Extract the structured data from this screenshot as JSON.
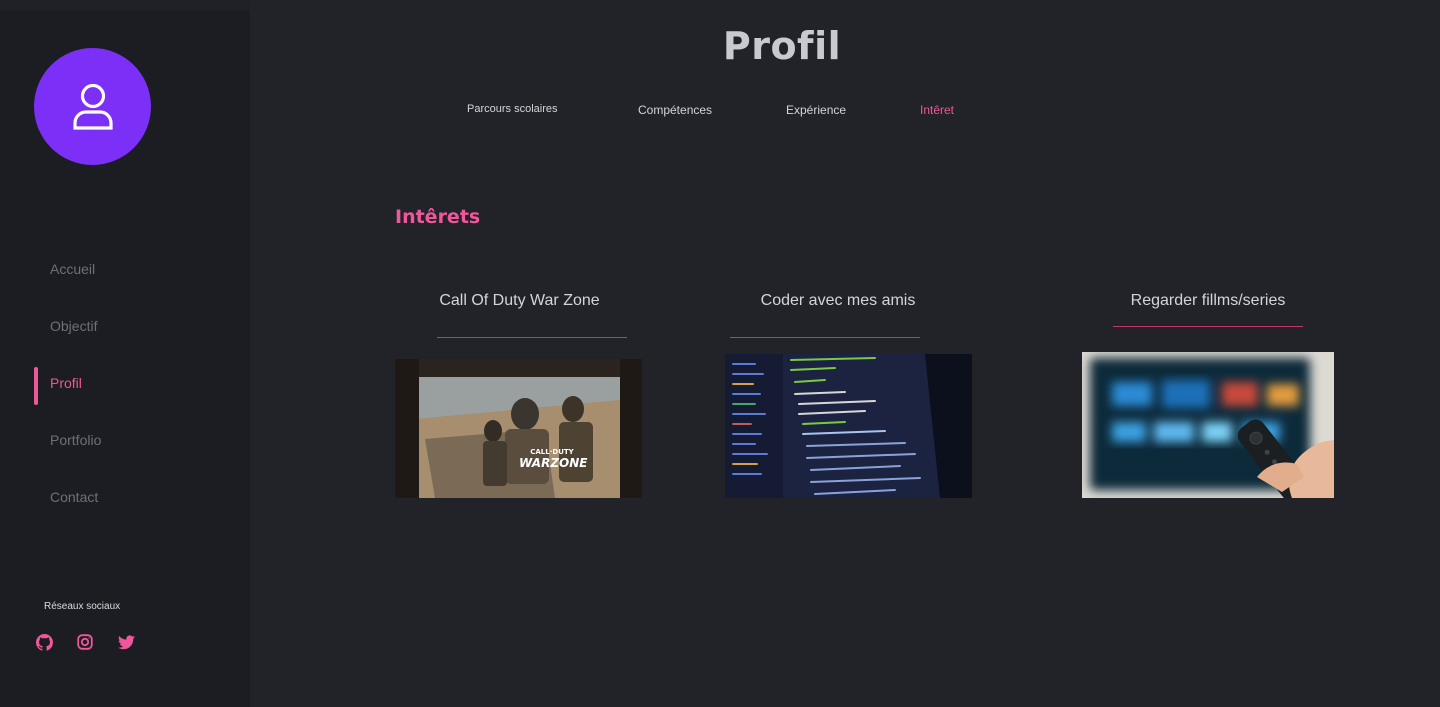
{
  "page": {
    "title": "Profil"
  },
  "sidebar": {
    "nav": [
      {
        "label": "Accueil"
      },
      {
        "label": "Objectif"
      },
      {
        "label": "Profil"
      },
      {
        "label": "Portfolio"
      },
      {
        "label": "Contact"
      }
    ],
    "socials_label": "Réseaux sociaux"
  },
  "tabs": [
    {
      "label": "Parcours scolaires"
    },
    {
      "label": "Compétences"
    },
    {
      "label": "Expérience"
    },
    {
      "label": "Intêret"
    }
  ],
  "section": {
    "title": "Intêrets"
  },
  "interests": [
    {
      "title": "Call Of Duty War Zone",
      "badge_top": "CALL·DUTY",
      "badge_bottom": "WARZONE"
    },
    {
      "title": "Coder avec mes amis"
    },
    {
      "title": "Regarder fillms/series"
    }
  ],
  "colors": {
    "accent": "#f0569a",
    "avatar": "#7b2ff7",
    "sidebar_bg": "#1c1d22",
    "main_bg": "#222329"
  }
}
